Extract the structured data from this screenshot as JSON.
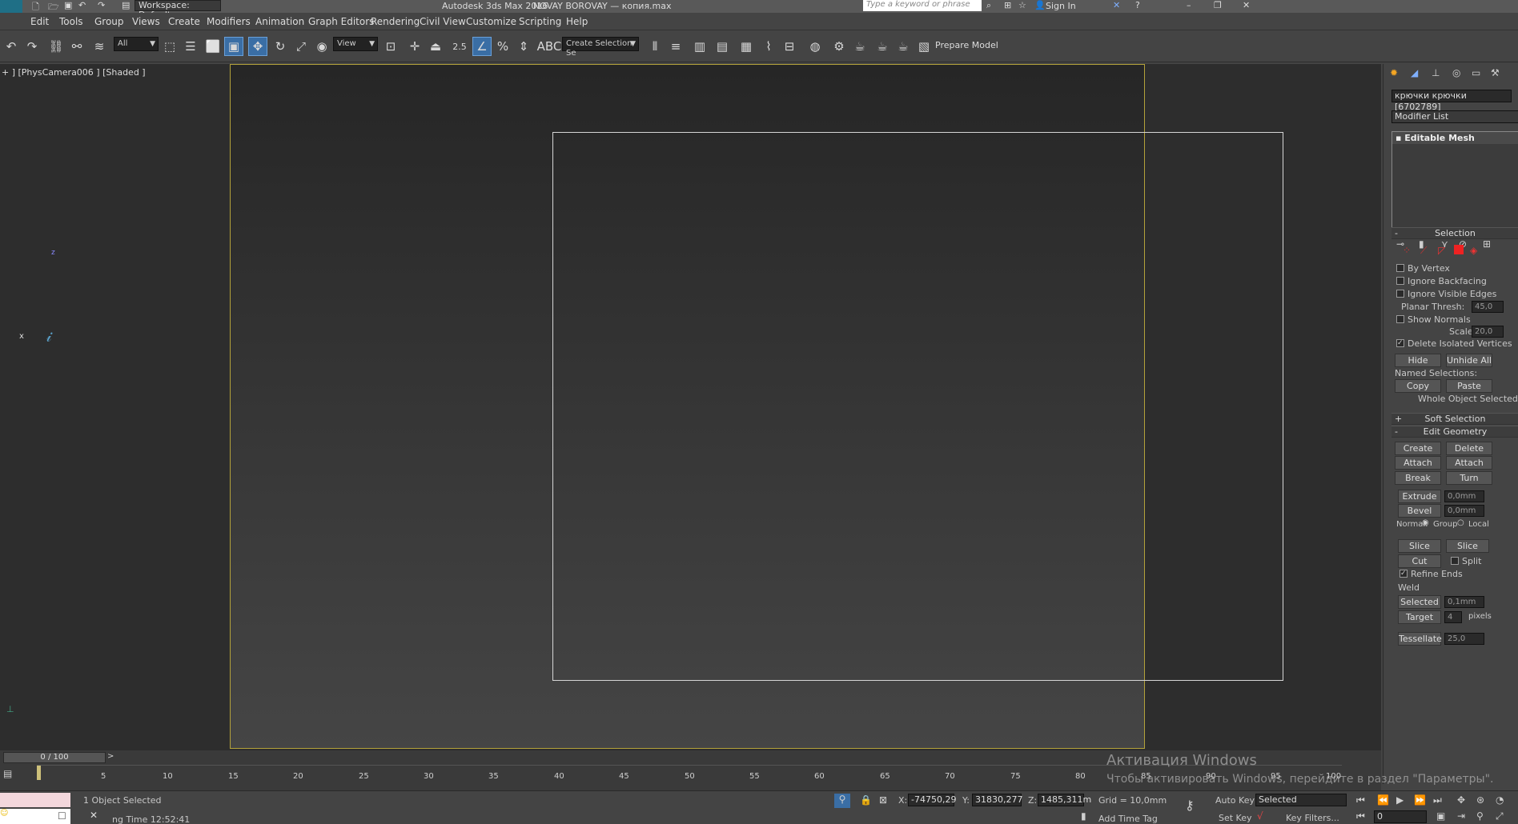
{
  "app": {
    "title": "Autodesk 3ds Max 2016",
    "file": "NOVAY BOROVAY — копия.max",
    "workspace": "Workspace: Default",
    "search_placeholder": "Type a keyword or phrase",
    "sign_in": "Sign In",
    "logo": "MAX"
  },
  "menu": [
    "Edit",
    "Tools",
    "Group",
    "Views",
    "Create",
    "Modifiers",
    "Animation",
    "Graph Editors",
    "Rendering",
    "Civil View",
    "Customize",
    "Scripting",
    "Help"
  ],
  "toolbar": {
    "selection_filter": "All",
    "ref_coord": "View",
    "snap_value": "2.5",
    "named_selection": "Create Selection Se",
    "prepare_model": "Prepare Model"
  },
  "viewport": {
    "label": "+ ] [PhysCamera006 ] [Shaded ]",
    "axis_z": "z",
    "axis_x": "x"
  },
  "cmd": {
    "object_name": "крючки крючки [6702789]",
    "modifier_list": "Modifier List",
    "stack_item": "Editable Mesh",
    "selection": {
      "header": "Selection",
      "by_vertex": "By Vertex",
      "ignore_backfacing": "Ignore Backfacing",
      "ignore_visible_edges": "Ignore Visible Edges",
      "planar_thresh_label": "Planar Thresh:",
      "planar_thresh": "45,0",
      "show_normals": "Show Normals",
      "scale_label": "Scale:",
      "scale": "20,0",
      "delete_isolated": "Delete Isolated Vertices",
      "hide": "Hide",
      "unhide_all": "Unhide All",
      "named_selections": "Named Selections:",
      "copy": "Copy",
      "paste": "Paste",
      "status": "Whole Object Selected"
    },
    "soft_selection": "Soft Selection",
    "edit_geometry": {
      "header": "Edit Geometry",
      "create": "Create",
      "delete": "Delete",
      "attach": "Attach",
      "attach_list": "Attach List",
      "break": "Break",
      "turn": "Turn",
      "extrude": "Extrude",
      "extrude_val": "0,0mm",
      "bevel": "Bevel",
      "bevel_val": "0,0mm",
      "normal": "Normal:",
      "group": "Group",
      "local": "Local",
      "slice_plane": "Slice Plane",
      "slice": "Slice",
      "cut": "Cut",
      "split": "Split",
      "refine_ends": "Refine Ends",
      "weld": "Weld",
      "selected": "Selected",
      "selected_val": "0,1mm",
      "target": "Target",
      "target_val": "4",
      "pixels": "pixels",
      "tessellate": "Tessellate",
      "tessellate_val": "25,0"
    }
  },
  "timeline": {
    "frame": "0 / 100",
    "ticks": [
      "5",
      "10",
      "15",
      "20",
      "25",
      "30",
      "35",
      "40",
      "45",
      "50",
      "55",
      "60",
      "65",
      "70",
      "75",
      "80",
      "85",
      "90",
      "95",
      "100"
    ]
  },
  "status": {
    "selected_text": "1 Object Selected",
    "time_text": "ng Time 12:52:41",
    "x_label": "X:",
    "x": "-74750,29",
    "y_label": "Y:",
    "y": "31830,277",
    "z_label": "Z:",
    "z": "1485,311m",
    "grid": "Grid = 10,0mm",
    "add_time_tag": "Add Time Tag",
    "auto_key": "Auto Key",
    "key_mode": "Selected",
    "set_key": "Set Key",
    "key_filters": "Key Filters...",
    "frame_field": "0"
  },
  "watermark": {
    "title": "Активация Windows",
    "body": "Чтобы активировать Windows, перейдите в раздел \"Параметры\"."
  },
  "colors": {
    "accent": "#3a6ea5",
    "safe_frame": "#b4a23a"
  }
}
